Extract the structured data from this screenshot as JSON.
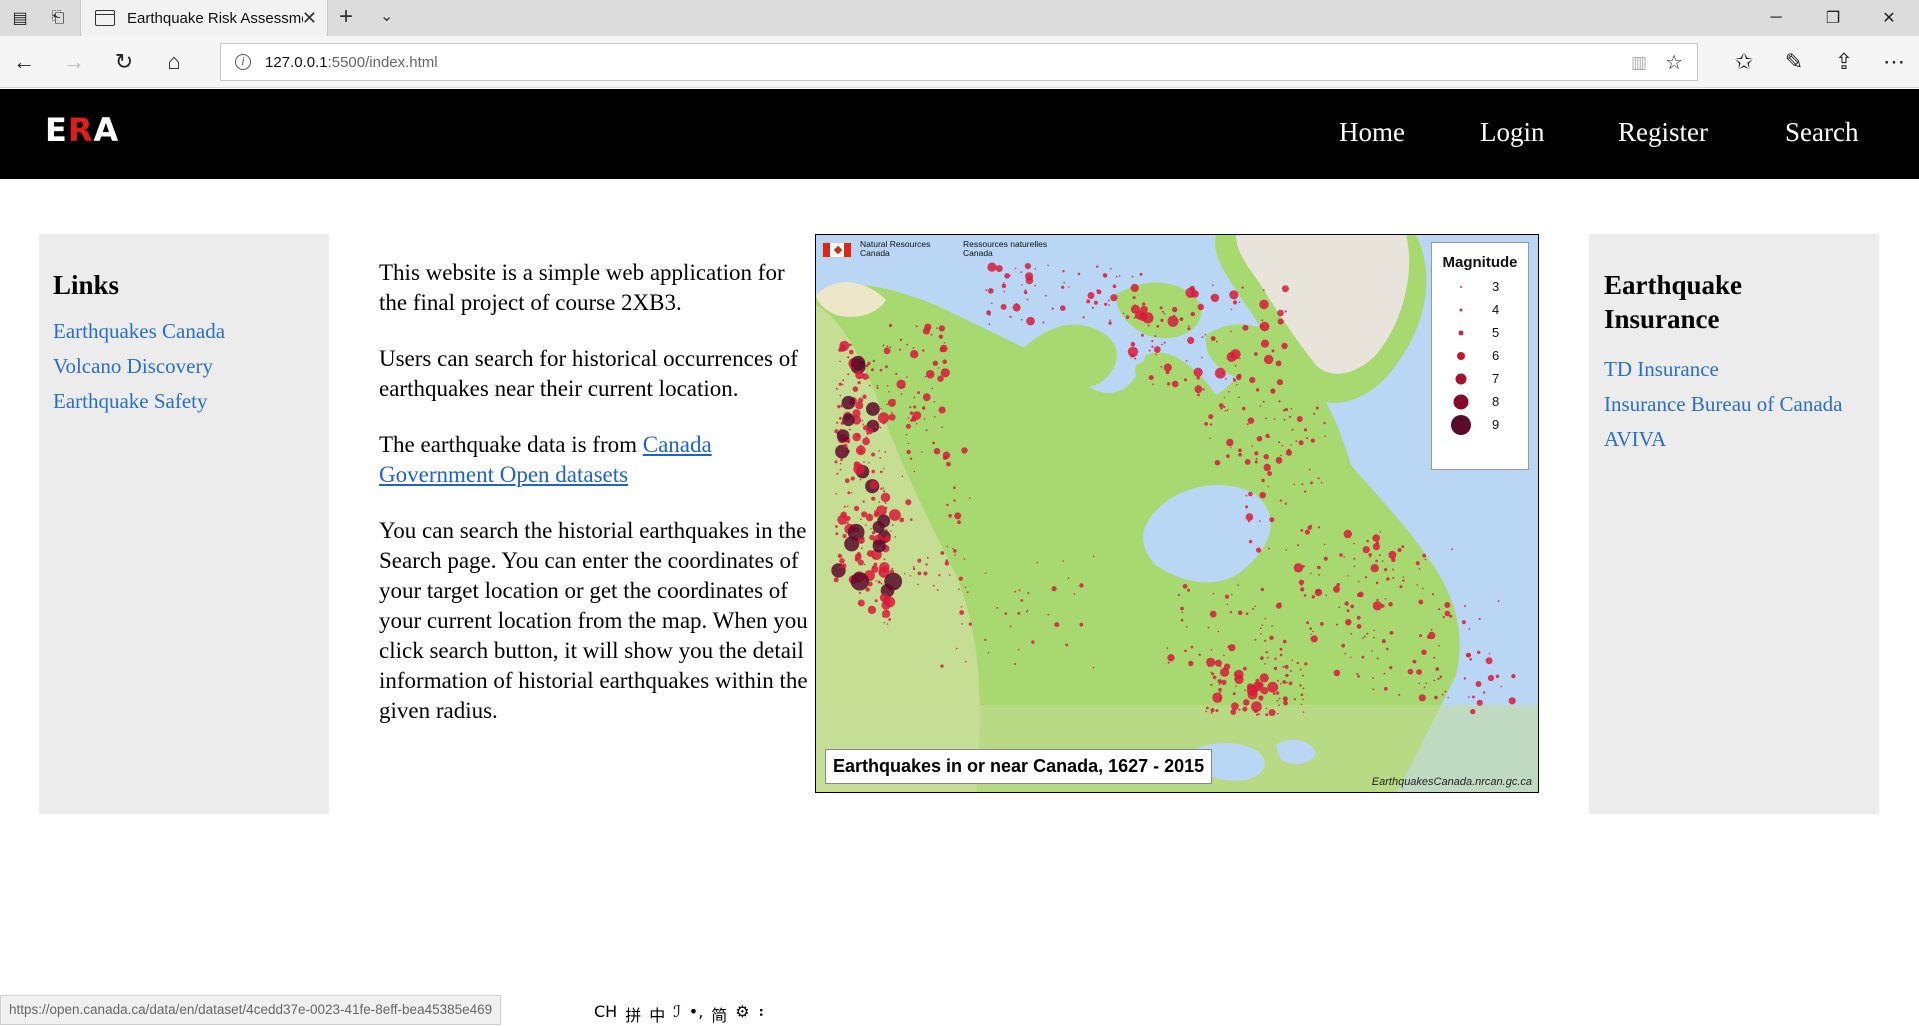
{
  "browser": {
    "tab_title": "Earthquake Risk Assessment",
    "url_host": "127.0.0.1",
    "url_path": ":5500/index.html",
    "status_url": "https://open.canada.ca/data/en/dataset/4cedd37e-0023-41fe-8eff-bea45385e469",
    "ime": [
      "CH",
      "拼",
      "中",
      "ℐ",
      "•,",
      "简",
      "⚙",
      "⠆"
    ]
  },
  "site": {
    "logo_left": "E",
    "logo_accent": "R",
    "logo_right": "A",
    "nav": [
      "Home",
      "Login",
      "Register",
      "Search"
    ]
  },
  "links_panel": {
    "title": "Links",
    "items": [
      "Earthquakes Canada",
      "Volcano Discovery",
      "Earthquake Safety"
    ]
  },
  "intro": {
    "p1": "This website is a simple web application for the final project of course 2XB3.",
    "p2": "Users can search for historical occurrences of earthquakes near their current location.",
    "p3_prefix": "The earthquake data is from ",
    "p3_link": "Canada Government Open datasets",
    "p4": "You can search the historial earthquakes in the Search page. You can enter the coordinates of your target location or get the coordinates of your current location from the map. When you click search button, it will show you the detail information of historial earthquakes within the given radius."
  },
  "map": {
    "header_en": "Natural Resources Canada",
    "header_fr": "Ressources naturelles Canada",
    "legend_title": "Magnitude",
    "legend_levels": [
      "3",
      "4",
      "5",
      "6",
      "7",
      "8",
      "9"
    ],
    "title": "Earthquakes in or near Canada, 1627 - 2015",
    "credit": "EarthquakesCanada.nrcan.gc.ca",
    "colors": {
      "water": "#b9d6f4",
      "land": "#a6d46e",
      "mountain": "#e6d5a8",
      "ice": "#e8e8e8",
      "quake": "#d81b3b",
      "quake_dark": "#5a0a2a"
    }
  },
  "insurance_panel": {
    "title": "Earthquake Insurance",
    "items": [
      "TD Insurance",
      "Insurance Bureau of Canada",
      "AVIVA"
    ]
  }
}
